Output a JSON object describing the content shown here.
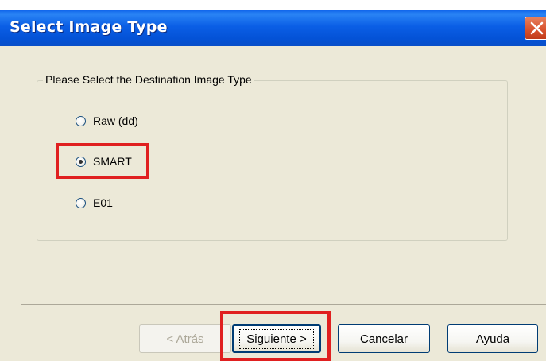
{
  "window": {
    "title": "Select Image Type",
    "close_icon": "close-icon"
  },
  "group": {
    "legend": "Please Select the Destination Image Type",
    "options": [
      {
        "label": "Raw (dd)",
        "checked": false
      },
      {
        "label": "SMART",
        "checked": true
      },
      {
        "label": "E01",
        "checked": false
      }
    ]
  },
  "buttons": {
    "back": "< Atrás",
    "next": "Siguiente >",
    "cancel": "Cancelar",
    "help": "Ayuda"
  },
  "colors": {
    "titlebar": "#0452d6",
    "highlight": "#e02020",
    "dialog_bg": "#ece9d8"
  }
}
